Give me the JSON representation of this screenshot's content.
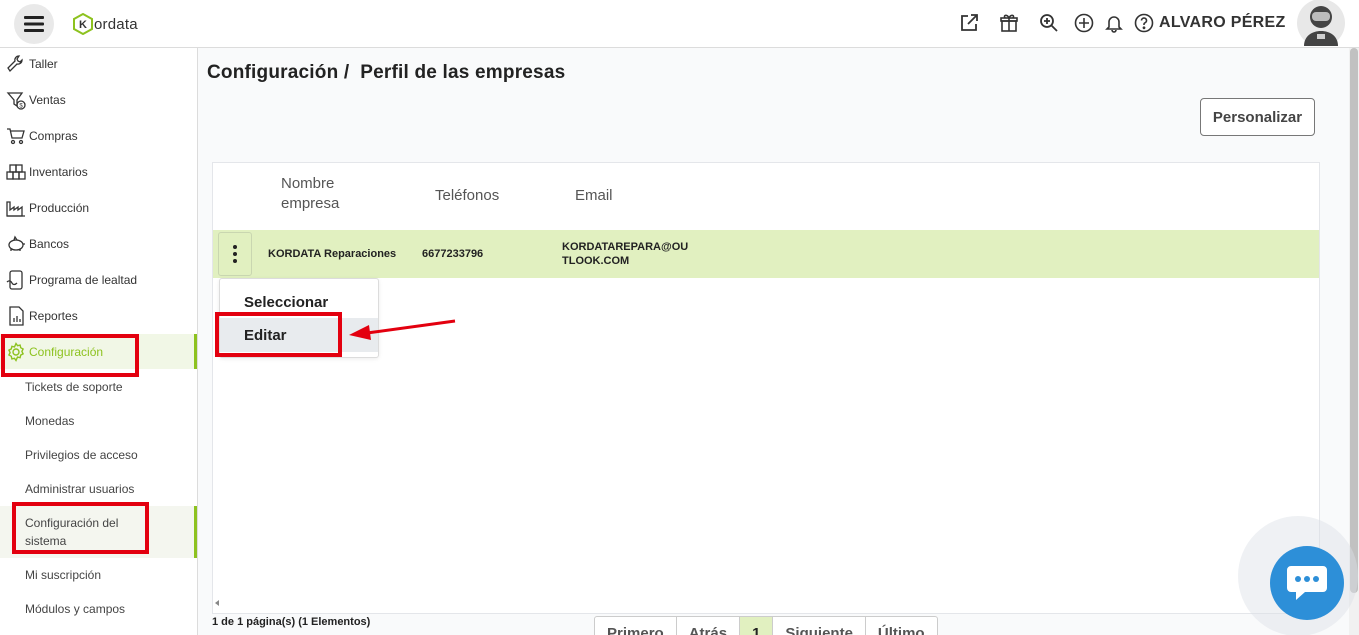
{
  "app": {
    "logo_text": "ordata",
    "logo_letter": "K",
    "brand_color": "#8dc21f"
  },
  "header": {
    "user_name": "ALVARO PÉREZ",
    "icons": [
      "external-link-icon",
      "gift-icon",
      "search-zoom-icon",
      "add-circle-icon",
      "bell-icon",
      "help-icon"
    ]
  },
  "sidebar": {
    "items": [
      {
        "label": "Taller",
        "icon": "wrench-icon"
      },
      {
        "label": "Ventas",
        "icon": "sales-icon"
      },
      {
        "label": "Compras",
        "icon": "cart-icon"
      },
      {
        "label": "Inventarios",
        "icon": "boxes-icon"
      },
      {
        "label": "Producción",
        "icon": "factory-icon"
      },
      {
        "label": "Bancos",
        "icon": "piggy-bank-icon"
      },
      {
        "label": "Programa de lealtad",
        "icon": "loyalty-icon"
      },
      {
        "label": "Reportes",
        "icon": "report-icon"
      },
      {
        "label": "Configuración",
        "icon": "gear-icon"
      }
    ],
    "sub_items": [
      {
        "label": "Tickets de soporte"
      },
      {
        "label": "Monedas"
      },
      {
        "label": "Privilegios de acceso"
      },
      {
        "label": "Administrar usuarios"
      },
      {
        "label": "Configuración del sistema"
      },
      {
        "label": "Mi suscripción"
      },
      {
        "label": "Módulos y campos"
      }
    ]
  },
  "main": {
    "breadcrumb": "Configuración /  Perfil de las empresas",
    "customize_button": "Personalizar",
    "table": {
      "columns": [
        "Nombre empresa",
        "Teléfonos",
        "Email"
      ],
      "rows": [
        {
          "name": "KORDATA Reparaciones",
          "phone": "6677233796",
          "email": "KORDATAREPARA@OUTLOOK.COM"
        }
      ]
    },
    "row_menu": {
      "options": [
        "Seleccionar",
        "Editar"
      ]
    },
    "pagination": {
      "info": "1 de 1 página(s) (1 Elementos)",
      "first": "Primero",
      "prev": "Atrás",
      "current": "1",
      "next": "Siguiente",
      "last": "Último"
    }
  }
}
